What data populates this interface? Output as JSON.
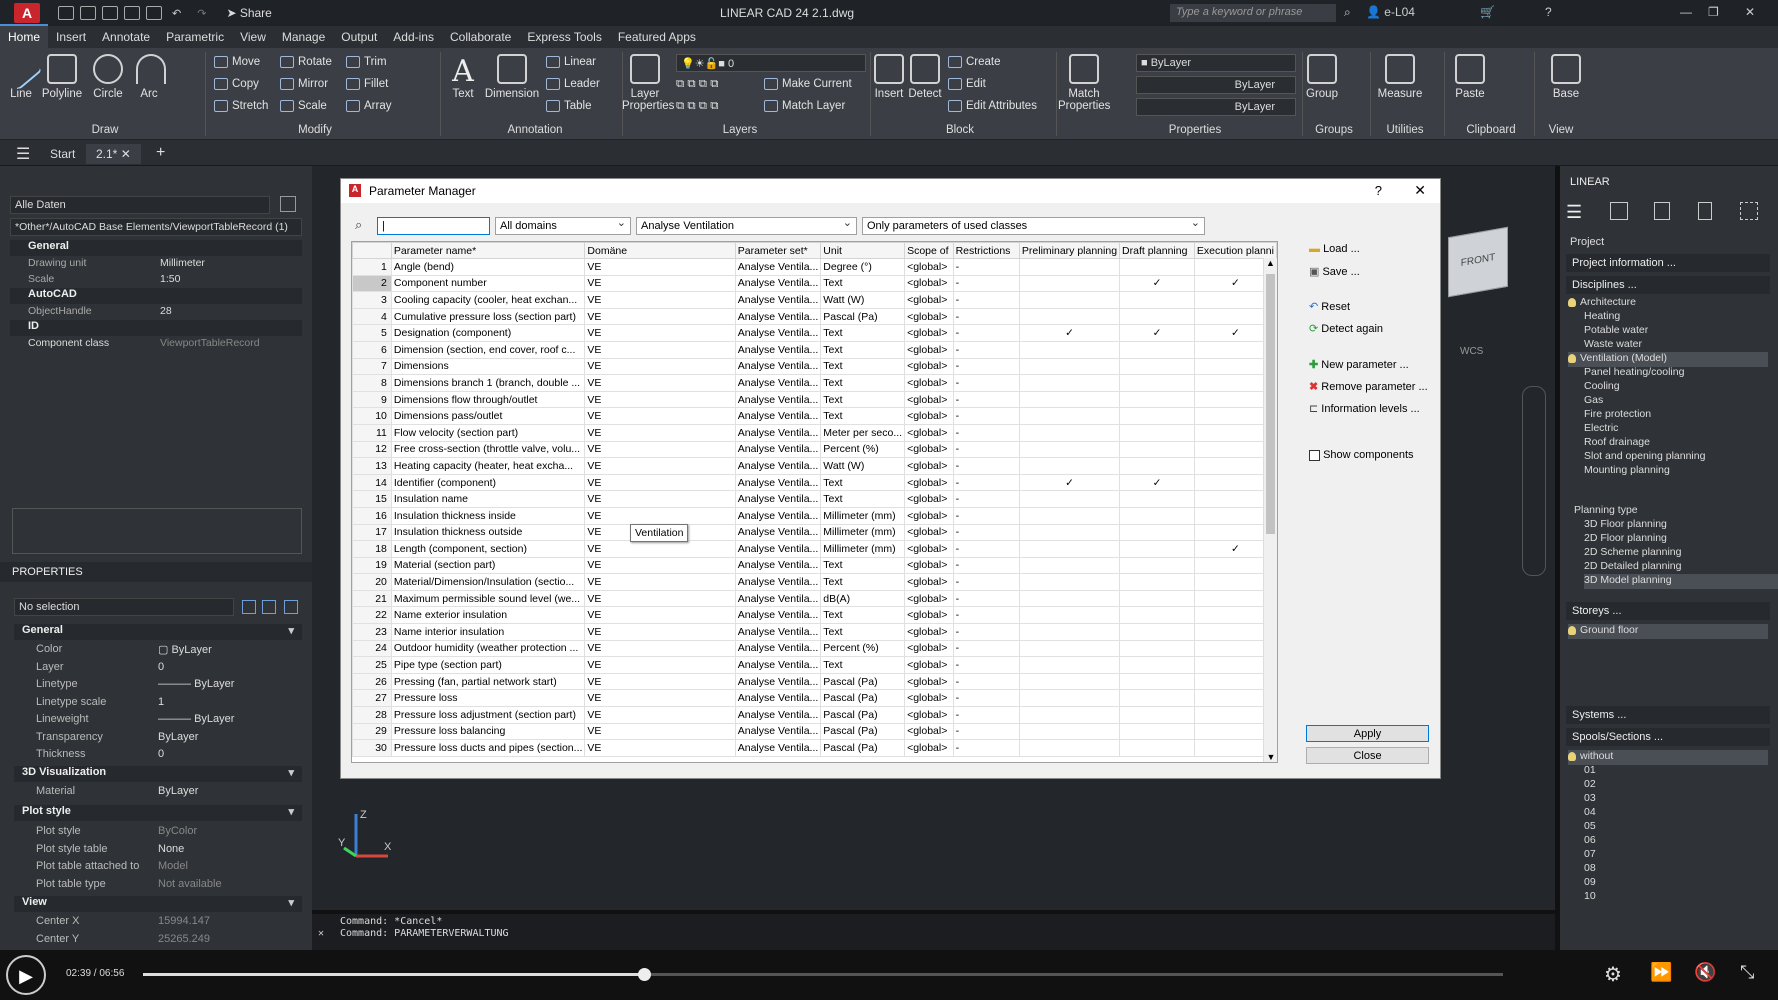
{
  "titlebar": {
    "logo": "A",
    "title": "LINEAR CAD 24   2.1.dwg",
    "share": "Share",
    "search_placeholder": "Type a keyword or phrase",
    "user": "e-L04"
  },
  "menu": [
    "Home",
    "Insert",
    "Annotate",
    "Parametric",
    "View",
    "Manage",
    "Output",
    "Add-ins",
    "Collaborate",
    "Express Tools",
    "Featured Apps"
  ],
  "ribbon": {
    "draw": {
      "line": "Line",
      "polyline": "Polyline",
      "circle": "Circle",
      "arc": "Arc",
      "panel": "Draw"
    },
    "modify": {
      "move": "Move",
      "rotate": "Rotate",
      "trim": "Trim",
      "copy": "Copy",
      "mirror": "Mirror",
      "fillet": "Fillet",
      "stretch": "Stretch",
      "scale": "Scale",
      "array": "Array",
      "panel": "Modify"
    },
    "annotation": {
      "text": "Text",
      "dimension": "Dimension",
      "linear": "Linear",
      "leader": "Leader",
      "table": "Table",
      "panel": "Annotation"
    },
    "layers": {
      "layer_properties": "Layer Properties",
      "layer_value": "0",
      "make_current": "Make Current",
      "match_layer": "Match Layer",
      "panel": "Layers"
    },
    "block": {
      "insert": "Insert",
      "detect": "Detect",
      "create": "Create",
      "edit": "Edit",
      "edit_attributes": "Edit Attributes",
      "panel": "Block"
    },
    "properties": {
      "match": "Match Properties",
      "bylayer1": "ByLayer",
      "bylayer2": "ByLayer",
      "bylayer3": "ByLayer",
      "panel": "Properties"
    },
    "groups": {
      "group": "Group",
      "panel": "Groups"
    },
    "utilities": {
      "measure": "Measure",
      "panel": "Utilities"
    },
    "clipboard": {
      "paste": "Paste",
      "panel": "Clipboard"
    },
    "view": {
      "base": "Base",
      "panel": "View"
    }
  },
  "tabs": {
    "start": "Start",
    "file": "2.1*"
  },
  "leftpanel": {
    "dropdown1": "Alle Daten",
    "dropdown2": "*Other*/AutoCAD Base Elements/ViewportTableRecord (1)",
    "general": "General",
    "drawing_unit_k": "Drawing unit",
    "drawing_unit_v": "Millimeter",
    "scale_k": "Scale",
    "scale_v": "1:50",
    "autocad": "AutoCAD",
    "objecthandle_k": "ObjectHandle",
    "objecthandle_v": "28",
    "id": "ID",
    "component_class_k": "Component class",
    "component_class_v": "ViewportTableRecord"
  },
  "properties": {
    "title": "PROPERTIES",
    "selection": "No selection",
    "general": "General",
    "color_k": "Color",
    "color_v": "ByLayer",
    "layer_k": "Layer",
    "layer_v": "0",
    "linetype_k": "Linetype",
    "linetype_v": "ByLayer",
    "ltscale_k": "Linetype scale",
    "ltscale_v": "1",
    "lineweight_k": "Lineweight",
    "lineweight_v": "ByLayer",
    "transparency_k": "Transparency",
    "transparency_v": "ByLayer",
    "thickness_k": "Thickness",
    "thickness_v": "0",
    "viz": "3D Visualization",
    "material_k": "Material",
    "material_v": "ByLayer",
    "plot": "Plot style",
    "plotstyle_k": "Plot style",
    "plotstyle_v": "ByColor",
    "plottable_k": "Plot style table",
    "plottable_v": "None",
    "plotattached_k": "Plot table attached to",
    "plotattached_v": "Model",
    "plottype_k": "Plot table type",
    "plottype_v": "Not available",
    "view": "View",
    "centerx_k": "Center X",
    "centerx_v": "15994.147",
    "centery_k": "Center Y",
    "centery_v": "25265.249"
  },
  "command": {
    "line1": "Command: *Cancel*",
    "line2": "Command: PARAMETERVERWALTUNG"
  },
  "drawing": {
    "wcs": "WCS",
    "front": "FRONT"
  },
  "rightpanel": {
    "title": "LINEAR",
    "project": "Project",
    "project_info": "Project information ...",
    "disciplines": "Disciplines ...",
    "disc_items": [
      "Architecture",
      "Heating",
      "Potable water",
      "Waste water",
      "Ventilation (Model)",
      "Panel heating/cooling",
      "Cooling",
      "Gas",
      "Fire protection",
      "Electric",
      "Roof drainage",
      "Slot and opening planning",
      "Mounting planning"
    ],
    "planning_type": "Planning type",
    "plan_items": [
      "3D Floor planning",
      "2D Floor planning",
      "2D Scheme planning",
      "2D Detailed planning",
      "3D Model planning"
    ],
    "storeys": "Storeys ...",
    "ground_floor": "Ground floor",
    "systems": "Systems ...",
    "spools": "Spools/Sections ...",
    "spool_items": [
      "without",
      "01",
      "02",
      "03",
      "04",
      "05",
      "06",
      "07",
      "08",
      "09",
      "10"
    ]
  },
  "player": {
    "time": "02:39 / 06:56",
    "progress": 0.3683
  },
  "dialog": {
    "title": "Parameter Manager",
    "filter_domain": "All domains",
    "filter_set": "Analyse Ventilation",
    "filter_classes": "Only parameters of used classes",
    "headers": [
      "",
      "Parameter name*",
      "Domäne",
      "Parameter set*",
      "Unit",
      "Scope of",
      "Restrictions",
      "Preliminary planning",
      "Draft planning",
      "Execution planni"
    ],
    "rows": [
      [
        "1",
        "Angle (bend)",
        "VE",
        "Analyse Ventila...",
        "Degree (°)",
        "<global>",
        "-",
        "",
        "",
        ""
      ],
      [
        "2",
        "Component number",
        "VE",
        "Analyse Ventila...",
        "Text",
        "<global>",
        "-",
        "",
        "✓",
        "✓"
      ],
      [
        "3",
        "Cooling capacity (cooler, heat exchan...",
        "VE",
        "Analyse Ventila...",
        "Watt (W)",
        "<global>",
        "-",
        "",
        "",
        ""
      ],
      [
        "4",
        "Cumulative pressure loss (section part)",
        "VE",
        "Analyse Ventila...",
        "Pascal (Pa)",
        "<global>",
        "-",
        "",
        "",
        ""
      ],
      [
        "5",
        "Designation (component)",
        "VE",
        "Analyse Ventila...",
        "Text",
        "<global>",
        "-",
        "✓",
        "✓",
        "✓"
      ],
      [
        "6",
        "Dimension (section, end cover, roof c...",
        "VE",
        "Analyse Ventila...",
        "Text",
        "<global>",
        "-",
        "",
        "",
        ""
      ],
      [
        "7",
        "Dimensions",
        "VE",
        "Analyse Ventila...",
        "Text",
        "<global>",
        "-",
        "",
        "",
        ""
      ],
      [
        "8",
        "Dimensions branch 1 (branch, double ...",
        "VE",
        "Analyse Ventila...",
        "Text",
        "<global>",
        "-",
        "",
        "",
        ""
      ],
      [
        "9",
        "Dimensions flow through/outlet",
        "VE",
        "Analyse Ventila...",
        "Text",
        "<global>",
        "-",
        "",
        "",
        ""
      ],
      [
        "10",
        "Dimensions pass/outlet",
        "VE",
        "Analyse Ventila...",
        "Text",
        "<global>",
        "-",
        "",
        "",
        ""
      ],
      [
        "11",
        "Flow velocity (section part)",
        "VE",
        "Analyse Ventila...",
        "Meter per seco...",
        "<global>",
        "-",
        "",
        "",
        ""
      ],
      [
        "12",
        "Free cross-section (throttle valve, volu...",
        "VE",
        "Analyse Ventila...",
        "Percent (%)",
        "<global>",
        "-",
        "",
        "",
        ""
      ],
      [
        "13",
        "Heating capacity (heater, heat excha...",
        "VE",
        "Analyse Ventila...",
        "Watt (W)",
        "<global>",
        "-",
        "",
        "",
        ""
      ],
      [
        "14",
        "Identifier (component)",
        "VE",
        "Analyse Ventila...",
        "Text",
        "<global>",
        "-",
        "✓",
        "✓",
        ""
      ],
      [
        "15",
        "Insulation name",
        "VE",
        "Analyse Ventila...",
        "Text",
        "<global>",
        "-",
        "",
        "",
        ""
      ],
      [
        "16",
        "Insulation thickness inside",
        "VE",
        "Analyse Ventila...",
        "Millimeter (mm)",
        "<global>",
        "-",
        "",
        "",
        ""
      ],
      [
        "17",
        "Insulation thickness outside",
        "VE",
        "Analyse Ventila...",
        "Millimeter (mm)",
        "<global>",
        "-",
        "",
        "",
        ""
      ],
      [
        "18",
        "Length (component, section)",
        "VE",
        "Analyse Ventila...",
        "Millimeter (mm)",
        "<global>",
        "-",
        "",
        "",
        "✓"
      ],
      [
        "19",
        "Material (section part)",
        "VE",
        "Analyse Ventila...",
        "Text",
        "<global>",
        "-",
        "",
        "",
        ""
      ],
      [
        "20",
        "Material/Dimension/Insulation (sectio...",
        "VE",
        "Analyse Ventila...",
        "Text",
        "<global>",
        "-",
        "",
        "",
        ""
      ],
      [
        "21",
        "Maximum permissible sound level (we...",
        "VE",
        "Analyse Ventila...",
        "dB(A)",
        "<global>",
        "-",
        "",
        "",
        ""
      ],
      [
        "22",
        "Name exterior insulation",
        "VE",
        "Analyse Ventila...",
        "Text",
        "<global>",
        "-",
        "",
        "",
        ""
      ],
      [
        "23",
        "Name interior insulation",
        "VE",
        "Analyse Ventila...",
        "Text",
        "<global>",
        "-",
        "",
        "",
        ""
      ],
      [
        "24",
        "Outdoor humidity (weather protection ...",
        "VE",
        "Analyse Ventila...",
        "Percent (%)",
        "<global>",
        "-",
        "",
        "",
        ""
      ],
      [
        "25",
        "Pipe type (section part)",
        "VE",
        "Analyse Ventila...",
        "Text",
        "<global>",
        "-",
        "",
        "",
        ""
      ],
      [
        "26",
        "Pressing (fan, partial network start)",
        "VE",
        "Analyse Ventila...",
        "Pascal (Pa)",
        "<global>",
        "-",
        "",
        "",
        ""
      ],
      [
        "27",
        "Pressure loss",
        "VE",
        "Analyse Ventila...",
        "Pascal (Pa)",
        "<global>",
        "-",
        "",
        "",
        ""
      ],
      [
        "28",
        "Pressure loss adjustment (section part)",
        "VE",
        "Analyse Ventila...",
        "Pascal (Pa)",
        "<global>",
        "-",
        "",
        "",
        ""
      ],
      [
        "29",
        "Pressure loss balancing",
        "VE",
        "Analyse Ventila...",
        "Pascal (Pa)",
        "<global>",
        "-",
        "",
        "",
        ""
      ],
      [
        "30",
        "Pressure loss ducts and pipes (section...",
        "VE",
        "Analyse Ventila...",
        "Pascal (Pa)",
        "<global>",
        "-",
        "",
        "",
        ""
      ]
    ],
    "tooltip": "Ventilation",
    "side": {
      "load": "Load ...",
      "save": "Save ...",
      "reset": "Reset",
      "detect": "Detect again",
      "new_param": "New parameter ...",
      "remove_param": "Remove parameter ...",
      "info_levels": "Information levels ...",
      "show_components": "Show components"
    },
    "apply": "Apply",
    "close": "Close"
  }
}
